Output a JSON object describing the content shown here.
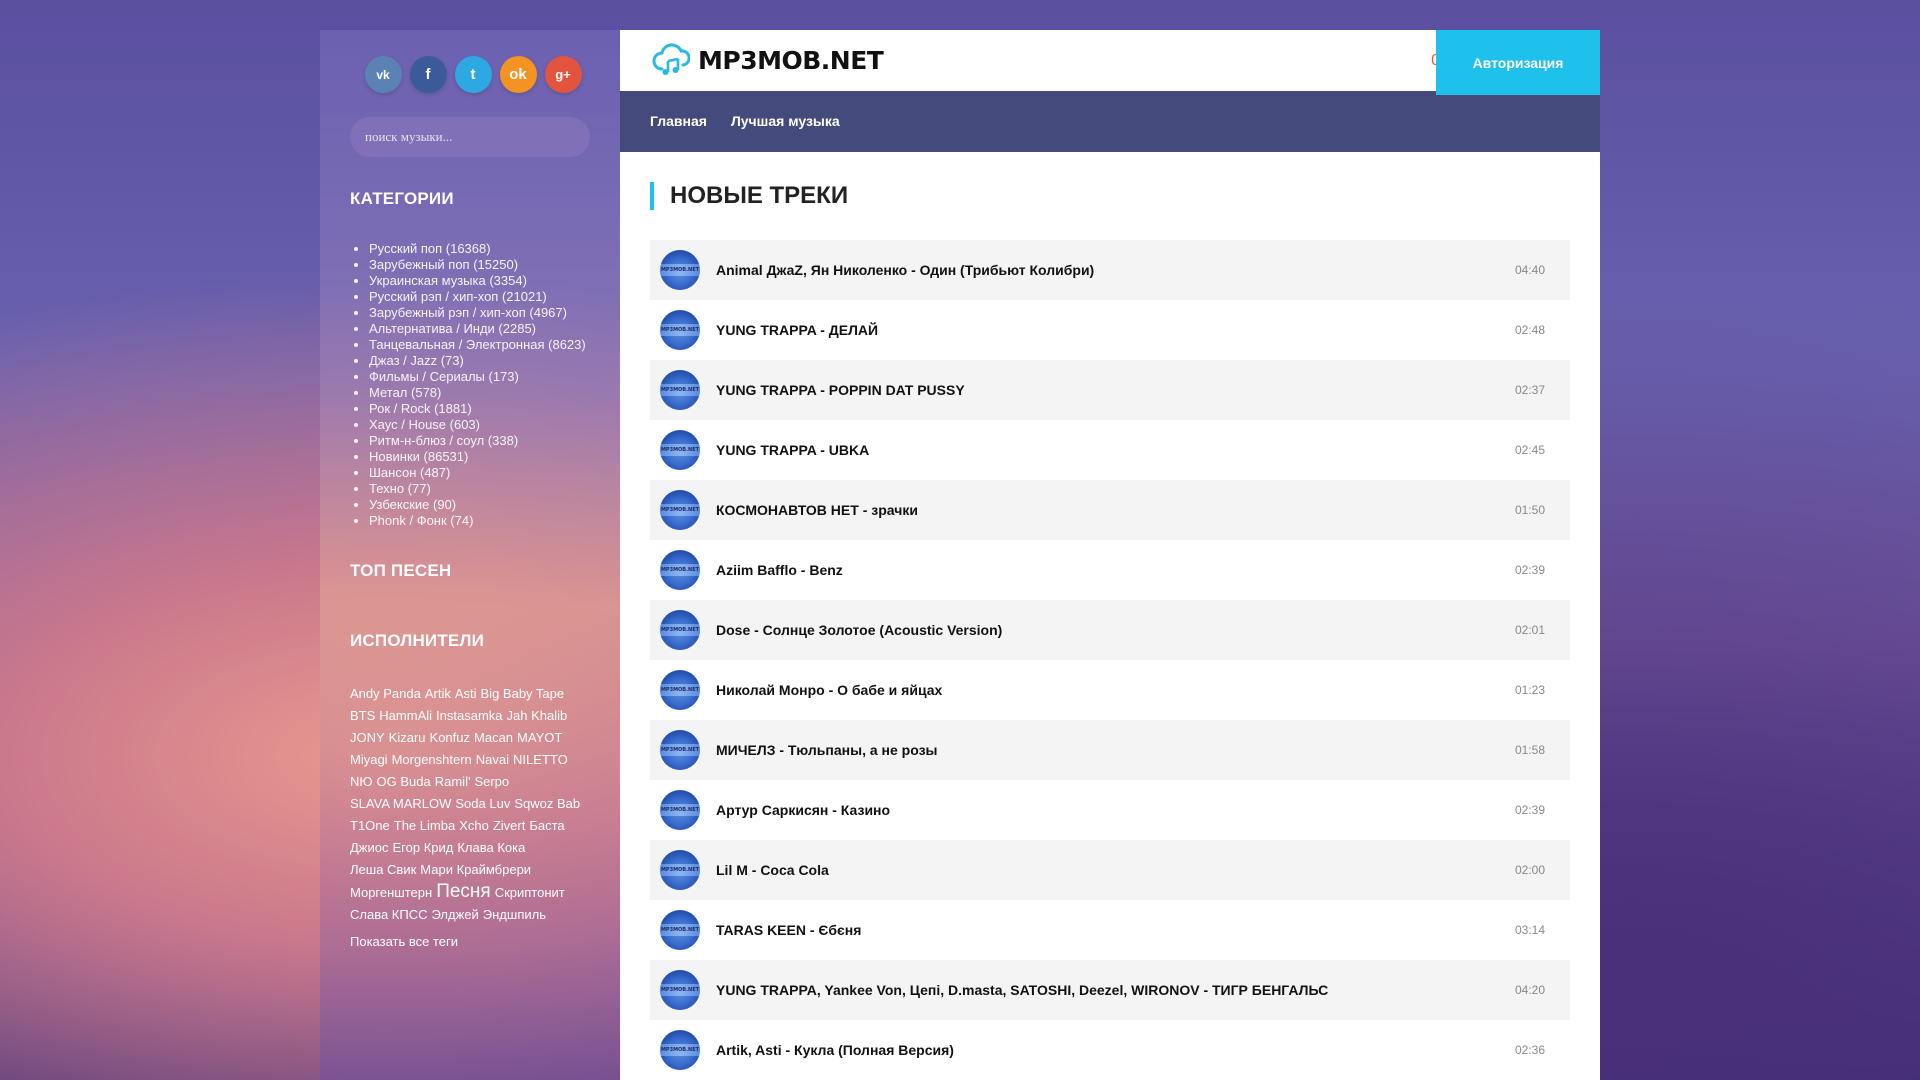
{
  "social": [
    "vk",
    "f",
    "t",
    "ok",
    "g+"
  ],
  "search": {
    "placeholder": "поиск музыки..."
  },
  "sidebar": {
    "categories_title": "КАТЕГОРИИ",
    "categories": [
      "Русский поп (16368)",
      "Зарубежный поп (15250)",
      "Украинская музыка (3354)",
      "Русский рэп / хип-хоп (21021)",
      "Зарубежный рэп / хип-хоп (4967)",
      "Альтернатива / Инди (2285)",
      "Танцевальная / Электронная (8623)",
      "Джаз / Jazz (73)",
      "Фильмы / Сериалы (173)",
      "Метал (578)",
      "Рок / Rock (1881)",
      "Хаус / House (603)",
      "Ритм-н-блюз / соул (338)",
      "Новинки (86531)",
      "Шансон (487)",
      "Техно (77)",
      "Узбекские (90)",
      "Phonk / Фонк (74)"
    ],
    "top_title": "ТОП ПЕСЕН",
    "artists_title": "ИСПОЛНИТЕЛИ",
    "tags": [
      "Andy Panda",
      "Artik",
      "Asti",
      "Big Baby Tape",
      "BTS",
      "HammAli",
      "Instasamka",
      "Jah Khalib",
      "JONY",
      "Kizaru",
      "Konfuz",
      "Macan",
      "MAYOT",
      "Miyagi",
      "Morgenshtern",
      "Navai",
      "NILETTO",
      "NЮ",
      "OG Buda",
      "Ramil'",
      "Serpo",
      "SLAVA MARLOW",
      "Soda Luv",
      "Sqwoz Bab",
      "T1One",
      "The Limba",
      "Xcho",
      "Zivert",
      "Баста",
      "Джиос",
      "Егор Крид",
      "Клава Кока",
      "Леша Свик",
      "Мари Краймбрери",
      "Моргенштерн",
      "Песня",
      "Скриптонит",
      "Слава КПСС",
      "Элджей",
      "Эндшпиль"
    ],
    "show_all": "Показать все теги"
  },
  "header": {
    "logo": "MP3MOB.NET",
    "counter": "0",
    "auth": "Авторизация"
  },
  "nav": [
    "Главная",
    "Лучшая музыка"
  ],
  "main": {
    "title": "НОВЫЕ ТРЕКИ",
    "tracks": [
      {
        "name": "Animal ДжаZ, Ян Николенко - Один (Трибьют Колибри)",
        "time": "04:40"
      },
      {
        "name": "YUNG TRAPPA - ДЕЛАЙ",
        "time": "02:48"
      },
      {
        "name": "YUNG TRAPPA - POPPIN DAT PUSSY",
        "time": "02:37"
      },
      {
        "name": "YUNG TRAPPA - UBKA",
        "time": "02:45"
      },
      {
        "name": "КОСМОНАВТОВ НЕТ - зрачки",
        "time": "01:50"
      },
      {
        "name": "Aziim Bafflo - Benz",
        "time": "02:39"
      },
      {
        "name": "Dose - Солнце Золотое (Acoustic Version)",
        "time": "02:01"
      },
      {
        "name": "Николай Монро - О бабе и яйцах",
        "time": "01:23"
      },
      {
        "name": "МИЧЕЛЗ - Тюльпаны, а не розы",
        "time": "01:58"
      },
      {
        "name": "Артур Саркисян - Казино",
        "time": "02:39"
      },
      {
        "name": "Lil M - Coca Cola",
        "time": "02:00"
      },
      {
        "name": "TARAS KEEN - Єбєня",
        "time": "03:14"
      },
      {
        "name": "YUNG TRAPPA, Yankee Von, Цепi, D.masta, SATOSHI, Deezel, WIRONOV - ТИГР БЕНГАЛЬС",
        "time": "04:20"
      },
      {
        "name": "Artik, Asti - Кукла (Полная Версия)",
        "time": "02:36"
      }
    ]
  }
}
